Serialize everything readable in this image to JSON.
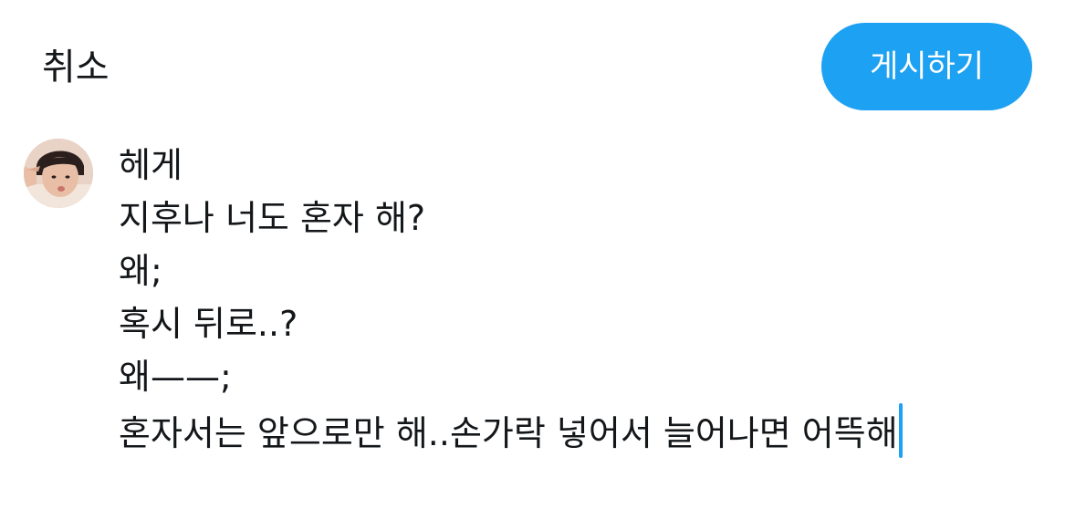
{
  "header": {
    "cancel_label": "취소",
    "post_label": "게시하기",
    "accent_color": "#1da1f2"
  },
  "composer": {
    "avatar_icon": "user-avatar",
    "lines": [
      "헤게",
      "지후나 너도 혼자 해?",
      "왜;",
      "혹시 뒤로..?",
      "왜——;",
      "혼자서는 앞으로만 해..손가락 넣어서 늘어나면 어뜩해"
    ]
  }
}
